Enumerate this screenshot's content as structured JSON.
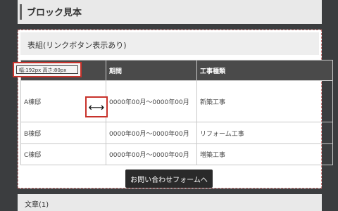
{
  "header": {
    "title": "ブロック見本"
  },
  "panel": {
    "title": "表組(リンクボタン表示あり)"
  },
  "size_badge": {
    "text": "幅:192px 高さ:80px"
  },
  "table": {
    "headers": [
      "",
      "期間",
      "工事種類"
    ],
    "rows": [
      [
        "A棟邸",
        "0000年00月～0000年00月",
        "新築工事"
      ],
      [
        "B棟邸",
        "0000年00月～0000年00月",
        "リフォーム工事"
      ],
      [
        "C棟邸",
        "0000年00月～0000年00月",
        "増築工事"
      ]
    ]
  },
  "icons": {
    "resize": "resize-horizontal-icon"
  },
  "buttons": {
    "contact_label": "お問い合わせフォームへ"
  },
  "bottom": {
    "title": "文章(1)"
  }
}
